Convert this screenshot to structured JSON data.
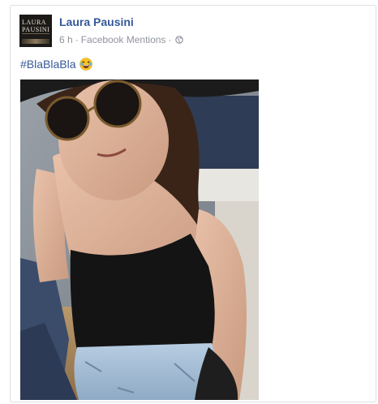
{
  "post": {
    "author": "Laura Pausini",
    "time": "6 h",
    "separator": "·",
    "source": "Facebook Mentions",
    "separator2": "·",
    "text": "#BlaBlaBla",
    "emoji": "laughing-emoji",
    "audience_icon": "globe-icon"
  },
  "avatar": {
    "logo_text_line1": "LAURA",
    "logo_text_line2": "PAUSINI"
  },
  "colors": {
    "link": "#365899",
    "meta": "#90949c",
    "border": "#dddfe2"
  }
}
